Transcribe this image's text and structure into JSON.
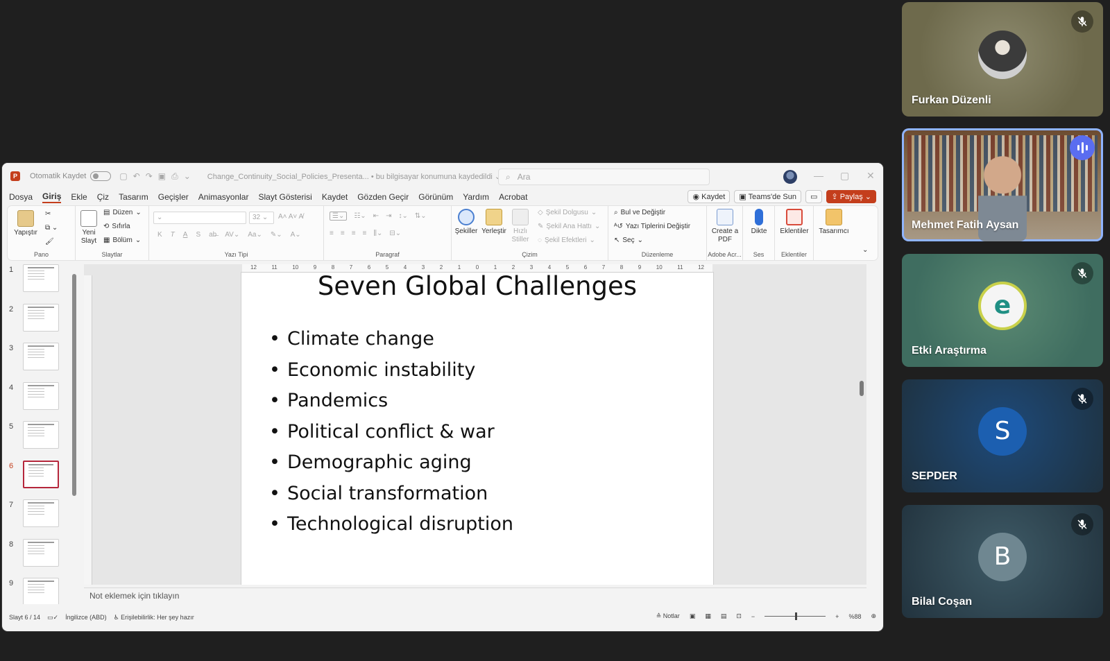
{
  "ppt": {
    "titlebar": {
      "autosave_label": "Otomatik Kaydet",
      "doc_name": "Change_Continuity_Social_Policies_Presenta... • bu bilgisayar konumuna kaydedildi ⌄",
      "search_placeholder": "Ara"
    },
    "menu": [
      "Dosya",
      "Giriş",
      "Ekle",
      "Çiz",
      "Tasarım",
      "Geçişler",
      "Animasyonlar",
      "Slayt Gösterisi",
      "Kaydet",
      "Gözden Geçir",
      "Görünüm",
      "Yardım",
      "Acrobat"
    ],
    "menu_active_index": 1,
    "menu_right": {
      "record": "Kaydet",
      "teams": "Teams'de Sun",
      "share": "Paylaş"
    },
    "ribbon": {
      "pano": {
        "label": "Pano",
        "paste": "Yapıştır"
      },
      "slaytlar": {
        "label": "Slaytlar",
        "new_slide": "Yeni Slayt",
        "layout": "Düzen",
        "reset": "Sıfırla",
        "section": "Bölüm"
      },
      "yazi_tipi": {
        "label": "Yazı Tipi",
        "size": "32",
        "bold": "K",
        "italic": "T",
        "underline": "A",
        "shadow": "S"
      },
      "paragraf": {
        "label": "Paragraf"
      },
      "cizim": {
        "label": "Çizim",
        "shapes": "Şekiller",
        "arrange": "Yerleştir",
        "quick_styles": "Hızlı Stiller",
        "fill": "Şekil Dolgusu",
        "outline": "Şekil Ana Hattı",
        "effects": "Şekil Efektleri"
      },
      "duzenleme": {
        "label": "Düzenleme",
        "find": "Bul ve Değiştir",
        "replace_fonts": "Yazı Tiplerini Değiştir",
        "select": "Seç"
      },
      "adobe": {
        "label": "Adobe Acr...",
        "create_pdf": "Create a PDF"
      },
      "ses": {
        "label": "Ses",
        "dictate": "Dikte"
      },
      "eklentiler": {
        "label": "Eklentiler",
        "addins": "Eklentiler"
      },
      "designer": "Tasarımcı"
    },
    "ruler_marks": [
      "12",
      "11",
      "10",
      "9",
      "8",
      "7",
      "6",
      "5",
      "4",
      "3",
      "2",
      "1",
      "0",
      "1",
      "2",
      "3",
      "4",
      "5",
      "6",
      "7",
      "8",
      "9",
      "10",
      "11",
      "12"
    ],
    "thumbnails": [
      {
        "num": "1"
      },
      {
        "num": "2"
      },
      {
        "num": "3"
      },
      {
        "num": "4"
      },
      {
        "num": "5"
      },
      {
        "num": "6"
      },
      {
        "num": "7"
      },
      {
        "num": "8"
      },
      {
        "num": "9"
      }
    ],
    "active_slide_index": 5,
    "slide": {
      "title": "Seven Global Challenges",
      "bullets": [
        "Climate change",
        "Economic instability",
        "Pandemics",
        "Political conflict & war",
        "Demographic aging",
        "Social transformation",
        "Technological disruption"
      ]
    },
    "notes_placeholder": "Not eklemek için tıklayın",
    "status": {
      "slide_counter": "Slayt 6 / 14",
      "language": "İngilizce (ABD)",
      "accessibility": "Erişilebilirlik: Her şey hazır",
      "notes": "Notlar",
      "zoom": "%88"
    }
  },
  "participants": [
    {
      "name": "Furkan Düzenli",
      "muted": true,
      "type": "photo",
      "bg": "#6e6a4c"
    },
    {
      "name": "Mehmet Fatih Aysan",
      "muted": false,
      "speaking": true,
      "type": "video",
      "bg": "#8a7a66"
    },
    {
      "name": "Etki Araştırma",
      "muted": true,
      "type": "logo",
      "bg": "#3f6d60"
    },
    {
      "name": "SEPDER",
      "muted": true,
      "type": "initial",
      "initial": "S",
      "bg": "#1d4a7a",
      "avatar_color": "#1c5fb0"
    },
    {
      "name": "Bilal Coşan",
      "muted": true,
      "type": "initial",
      "initial": "B",
      "bg": "#3e5a66",
      "avatar_color": "#6f8791"
    }
  ],
  "colors": {
    "accent": "#c43e1c",
    "active_speaker_border": "#8fb4ff"
  }
}
